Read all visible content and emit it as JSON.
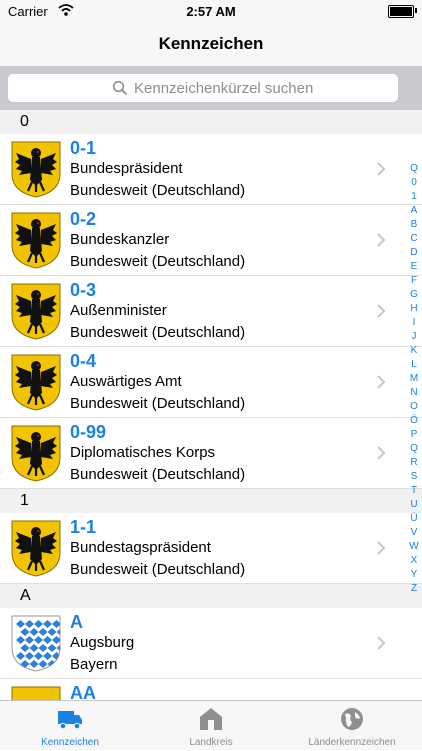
{
  "status_bar": {
    "carrier": "Carrier",
    "time": "2:57 AM"
  },
  "nav": {
    "title": "Kennzeichen"
  },
  "search": {
    "placeholder": "Kennzeichenkürzel suchen"
  },
  "sections": [
    {
      "header": "0",
      "rows": [
        {
          "code": "0-1",
          "name": "Bundespräsident",
          "region": "Bundesweit (Deutschland)",
          "icon": "germany-eagle-icon"
        },
        {
          "code": "0-2",
          "name": "Bundeskanzler",
          "region": "Bundesweit (Deutschland)",
          "icon": "germany-eagle-icon"
        },
        {
          "code": "0-3",
          "name": "Außenminister",
          "region": "Bundesweit (Deutschland)",
          "icon": "germany-eagle-icon"
        },
        {
          "code": "0-4",
          "name": "Auswärtiges Amt",
          "region": "Bundesweit (Deutschland)",
          "icon": "germany-eagle-icon"
        },
        {
          "code": "0-99",
          "name": "Diplomatisches Korps",
          "region": "Bundesweit (Deutschland)",
          "icon": "germany-eagle-icon"
        }
      ]
    },
    {
      "header": "1",
      "rows": [
        {
          "code": "1-1",
          "name": "Bundestagspräsident",
          "region": "Bundesweit (Deutschland)",
          "icon": "germany-eagle-icon"
        }
      ]
    },
    {
      "header": "A",
      "rows": [
        {
          "code": "A",
          "name": "Augsburg",
          "region": "Bayern",
          "icon": "bavaria-coat-of-arms-icon"
        },
        {
          "code": "AA",
          "name": "",
          "region": "",
          "icon": "baden-wuerttemberg-coat-of-arms-icon"
        }
      ]
    }
  ],
  "index": [
    "Q",
    "0",
    "1",
    "A",
    "B",
    "C",
    "D",
    "E",
    "F",
    "G",
    "H",
    "I",
    "J",
    "K",
    "L",
    "M",
    "N",
    "O",
    "Ö",
    "P",
    "Q",
    "R",
    "S",
    "T",
    "U",
    "Ü",
    "V",
    "W",
    "X",
    "Y",
    "Z"
  ],
  "tabs": [
    {
      "label": "Kennzeichen",
      "icon": "truck-icon",
      "active": true
    },
    {
      "label": "Landkreis",
      "icon": "house-icon",
      "active": false
    },
    {
      "label": "Länderkennzeichen",
      "icon": "globe-icon",
      "active": false
    }
  ],
  "colors": {
    "accent": "#1a82e6",
    "inactive": "#8e8e93",
    "eagle_bg": "#f2c300",
    "eagle": "#111111"
  }
}
